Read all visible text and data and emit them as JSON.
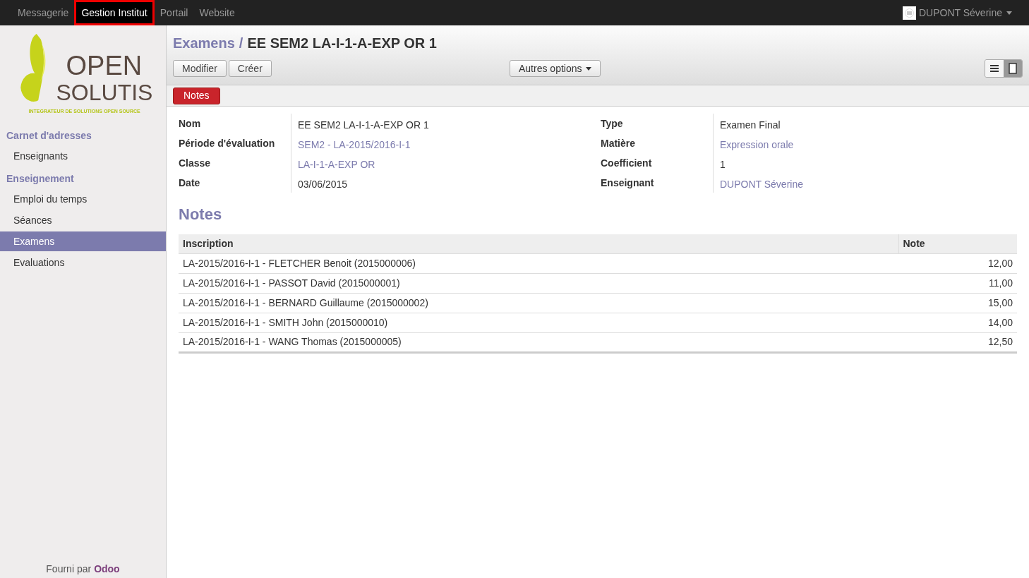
{
  "top_menu": [
    {
      "label": "Messagerie",
      "selected": false
    },
    {
      "label": "Gestion Institut",
      "selected": true
    },
    {
      "label": "Portail",
      "selected": false
    },
    {
      "label": "Website",
      "selected": false
    }
  ],
  "user": {
    "name": "DUPONT Séverine"
  },
  "logo": {
    "line_1": "OPEN",
    "line_2": "SOLUTIS",
    "tagline": "INTEGRATEUR DE SOLUTIONS OPEN SOURCE"
  },
  "sidebar": {
    "sections": [
      {
        "title": "Carnet d'adresses",
        "items": [
          {
            "label": "Enseignants",
            "selected": false
          }
        ]
      },
      {
        "title": "Enseignement",
        "items": [
          {
            "label": "Emploi du temps",
            "selected": false
          },
          {
            "label": "Séances",
            "selected": false
          },
          {
            "label": "Examens",
            "selected": true
          },
          {
            "label": "Evaluations",
            "selected": false
          }
        ]
      }
    ],
    "footer": {
      "text": "Fourni par",
      "link": "Odoo"
    }
  },
  "breadcrumb": {
    "parent": "Examens",
    "separator": "/",
    "current": "EE SEM2 LA-I-1-A-EXP OR 1"
  },
  "buttons": [
    "Modifier",
    "Créer"
  ],
  "more_options": "Autres options",
  "view_switcher": [
    {
      "kind": "list",
      "selected": false
    },
    {
      "kind": "form",
      "selected": true
    }
  ],
  "status_button": "Notes",
  "fields_left": [
    {
      "label": "Nom",
      "value": "EE SEM2 LA-I-1-A-EXP OR 1",
      "kind": "text"
    },
    {
      "label": "Période d'évaluation",
      "value": "SEM2 - LA-2015/2016-I-1",
      "kind": "link"
    },
    {
      "label": "Classe",
      "value": "LA-I-1-A-EXP OR",
      "kind": "link"
    },
    {
      "label": "Date",
      "value": "03/06/2015",
      "kind": "text"
    }
  ],
  "fields_right": [
    {
      "label": "Type",
      "value": "Examen Final",
      "kind": "text"
    },
    {
      "label": "Matière",
      "value": "Expression orale",
      "kind": "link"
    },
    {
      "label": "Coefficient",
      "value": "1",
      "kind": "text"
    },
    {
      "label": "Enseignant",
      "value": "DUPONT Séverine",
      "kind": "link"
    }
  ],
  "notes": {
    "title": "Notes",
    "columns": [
      "Inscription",
      "Note"
    ],
    "rows": [
      [
        "LA-2015/2016-I-1 - FLETCHER Benoit (2015000006)",
        "12,00"
      ],
      [
        "LA-2015/2016-I-1 - PASSOT David (2015000001)",
        "11,00"
      ],
      [
        "LA-2015/2016-I-1 - BERNARD Guillaume (2015000002)",
        "15,00"
      ],
      [
        "LA-2015/2016-I-1 - SMITH John (2015000010)",
        "14,00"
      ],
      [
        "LA-2015/2016-I-1 - WANG Thomas (2015000005)",
        "12,50"
      ]
    ]
  }
}
